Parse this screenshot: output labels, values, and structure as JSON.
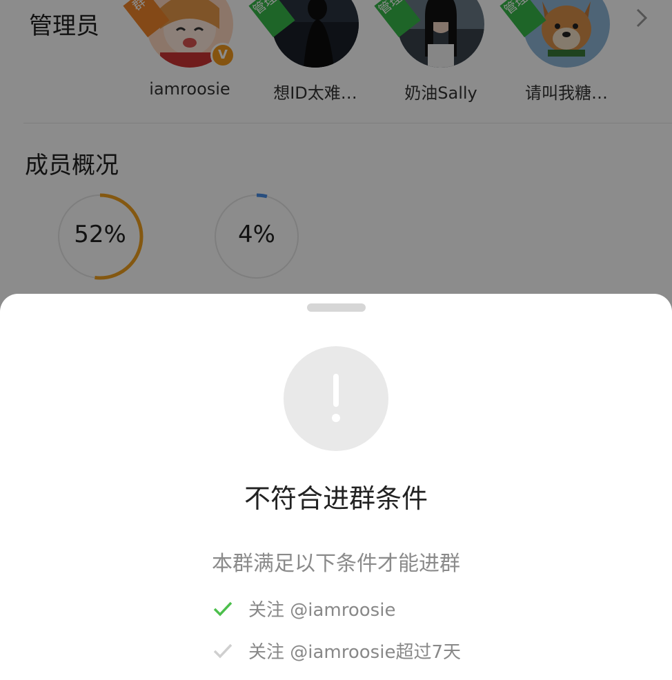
{
  "admins": {
    "title": "管理员",
    "items": [
      {
        "name": "iamroosie",
        "ribbon": "群",
        "ribbon_color": "#f0862a",
        "verified": true
      },
      {
        "name": "想ID太难…",
        "ribbon": "管理",
        "ribbon_color": "#37b94a"
      },
      {
        "name": "奶油Sally",
        "ribbon": "管理",
        "ribbon_color": "#37b94a"
      },
      {
        "name": "请叫我糖…",
        "ribbon": "管理",
        "ribbon_color": "#37b94a"
      }
    ],
    "verified_mark": "V"
  },
  "members": {
    "title": "成员概况",
    "stats": [
      {
        "value": "52%",
        "progress": 0.52,
        "color": "#f0a020"
      },
      {
        "value": "4%",
        "progress": 0.04,
        "color": "#4a8ee6"
      }
    ]
  },
  "sheet": {
    "icon": "exclamation-icon",
    "title": "不符合进群条件",
    "subtitle": "本群满足以下条件才能进群",
    "conditions": [
      {
        "text": "关注 @iamroosie",
        "met": true
      },
      {
        "text": "关注 @iamroosie超过7天",
        "met": false
      }
    ]
  },
  "colors": {
    "met": "#4cbf4c",
    "unmet": "#cfcfcf",
    "overlay": "rgba(0,0,0,0.45)"
  }
}
